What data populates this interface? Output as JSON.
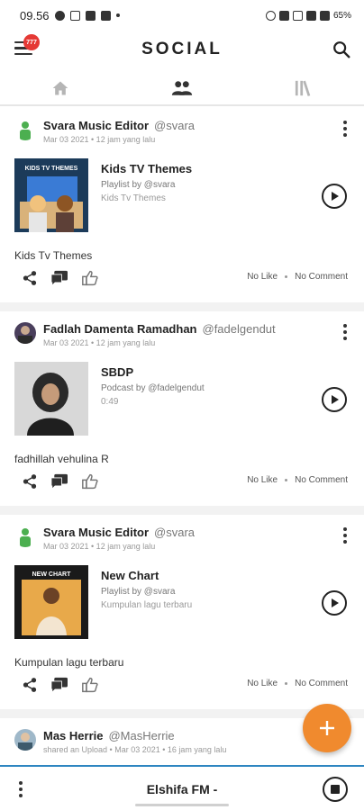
{
  "status_bar": {
    "time": "09.56",
    "battery": "65%"
  },
  "app_bar": {
    "title": "SOCIAL",
    "notification_count": "777"
  },
  "tabs": [
    {
      "icon": "home-icon"
    },
    {
      "icon": "people-icon"
    },
    {
      "icon": "library-icon"
    }
  ],
  "posts": [
    {
      "author": "Svara Music Editor",
      "handle": "@svara",
      "meta": "Mar 03 2021 • 12 jam yang lalu",
      "media_title": "Kids TV Themes",
      "media_sub": "Playlist by @svara",
      "media_sub2": "Kids Tv Themes",
      "caption": "Kids Tv Themes",
      "likes": "No Like",
      "comments": "No Comment"
    },
    {
      "author": "Fadlah Damenta Ramadhan",
      "handle": "@fadelgendut",
      "meta": "Mar 03 2021 • 12 jam yang lalu",
      "media_title": "SBDP",
      "media_sub": "Podcast by @fadelgendut",
      "media_sub2": "0:49",
      "caption": "fadhillah vehulina R",
      "likes": "No Like",
      "comments": "No Comment"
    },
    {
      "author": "Svara Music Editor",
      "handle": "@svara",
      "meta": "Mar 03 2021 • 12 jam yang lalu",
      "media_title": "New Chart",
      "media_sub": "Playlist by @svara",
      "media_sub2": "Kumpulan lagu terbaru",
      "caption": "Kumpulan lagu terbaru",
      "likes": "No Like",
      "comments": "No Comment"
    },
    {
      "author": "Mas Herrie",
      "handle": "@MasHerrie",
      "meta": "shared an Upload • Mar 03 2021 • 16 jam yang lalu"
    }
  ],
  "thumbnails": {
    "kids_label": "KIDS TV THEMES",
    "chart_label": "NEW CHART"
  },
  "player": {
    "title": "Elshifa FM -"
  },
  "colors": {
    "accent": "#f08a2e",
    "player_line": "#2e86c1",
    "badge": "#e53935"
  }
}
